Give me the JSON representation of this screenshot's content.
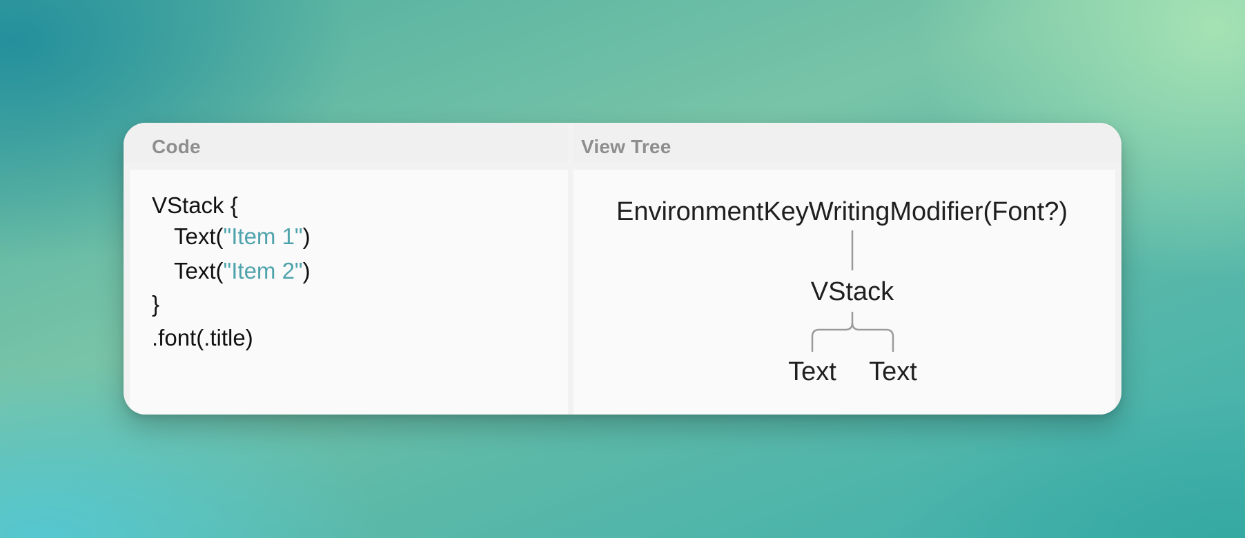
{
  "panels": {
    "code": {
      "title": "Code",
      "lines": [
        {
          "plain_before": "VStack {",
          "string": "",
          "plain_after": ""
        },
        {
          "plain_before": "Text(",
          "string": "\"Item 1\"",
          "plain_after": ")"
        },
        {
          "plain_before": "Text(",
          "string": "\"Item 2\"",
          "plain_after": ")"
        },
        {
          "plain_before": "}",
          "string": "",
          "plain_after": ""
        },
        {
          "plain_before": ".font(.title)",
          "string": "",
          "plain_after": ""
        }
      ]
    },
    "view_tree": {
      "title": "View Tree",
      "root": "EnvironmentKeyWritingModifier(Font?)",
      "child": "VStack",
      "leaves": [
        "Text",
        "Text"
      ]
    }
  },
  "colors": {
    "string_literal": "#4fa3ac",
    "header_text": "#8e8e8e",
    "connector": "#9a9a9a"
  }
}
